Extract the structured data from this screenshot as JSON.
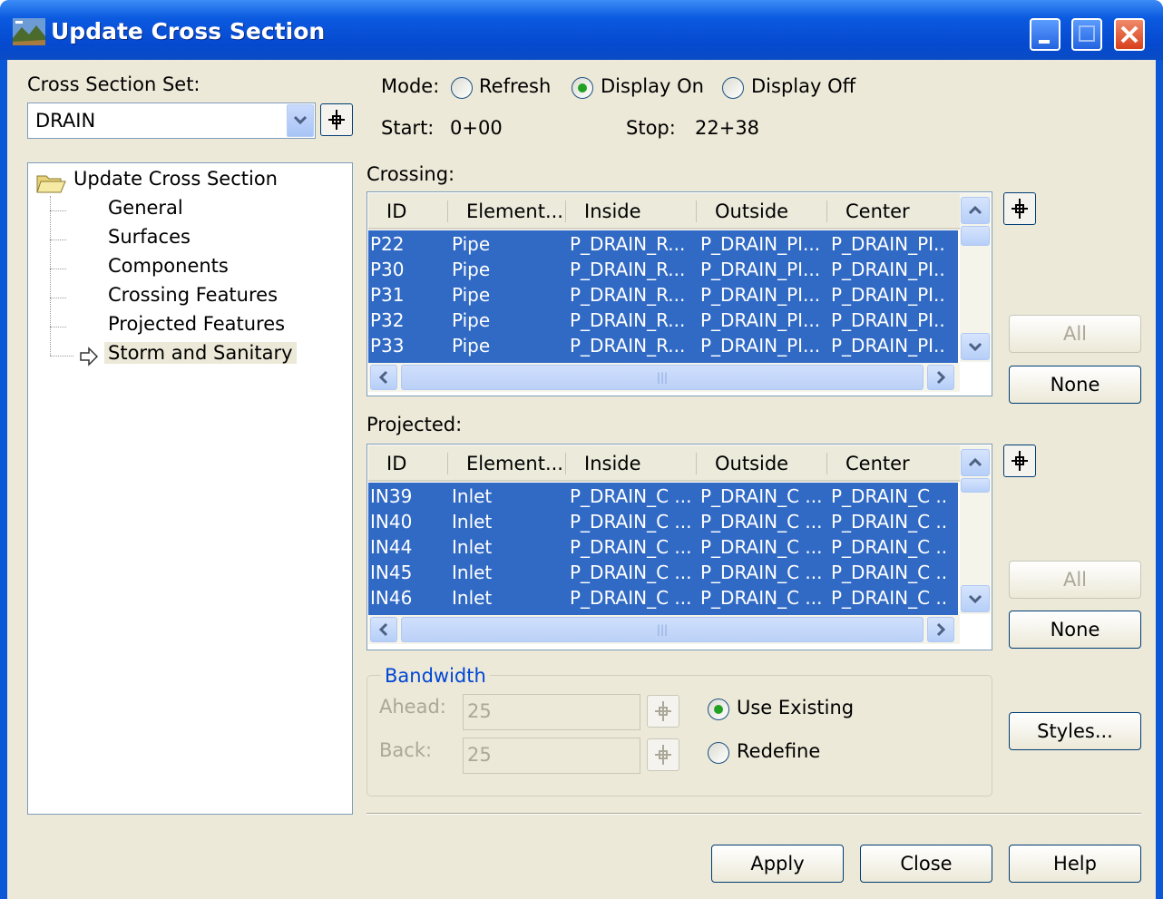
{
  "window": {
    "title": "Update Cross Section"
  },
  "cross_section_set": {
    "label": "Cross Section Set:",
    "value": "DRAIN"
  },
  "mode": {
    "label": "Mode:",
    "options": [
      "Refresh",
      "Display On",
      "Display Off"
    ],
    "selected": "Display On"
  },
  "range": {
    "start_label": "Start:",
    "start_value": "0+00",
    "stop_label": "Stop:",
    "stop_value": "22+38"
  },
  "tree": {
    "root": "Update Cross Section",
    "items": [
      "General",
      "Surfaces",
      "Components",
      "Crossing Features",
      "Projected Features",
      "Storm and Sanitary"
    ],
    "selected": "Storm and Sanitary"
  },
  "crossing": {
    "label": "Crossing:",
    "columns": [
      "ID",
      "Element...",
      "Inside",
      "Outside",
      "Center"
    ],
    "rows": [
      [
        "P22",
        "Pipe",
        "P_DRAIN_R...",
        "P_DRAIN_PI...",
        "P_DRAIN_PI.."
      ],
      [
        "P30",
        "Pipe",
        "P_DRAIN_R...",
        "P_DRAIN_PI...",
        "P_DRAIN_PI.."
      ],
      [
        "P31",
        "Pipe",
        "P_DRAIN_R...",
        "P_DRAIN_PI...",
        "P_DRAIN_PI.."
      ],
      [
        "P32",
        "Pipe",
        "P_DRAIN_R...",
        "P_DRAIN_PI...",
        "P_DRAIN_PI.."
      ],
      [
        "P33",
        "Pipe",
        "P_DRAIN_R...",
        "P_DRAIN_PI...",
        "P_DRAIN_PI.."
      ]
    ],
    "all_label": "All",
    "none_label": "None"
  },
  "projected": {
    "label": "Projected:",
    "columns": [
      "ID",
      "Element...",
      "Inside",
      "Outside",
      "Center"
    ],
    "rows": [
      [
        "IN39",
        "Inlet",
        "P_DRAIN_C ...",
        "P_DRAIN_C ...",
        "P_DRAIN_C .."
      ],
      [
        "IN40",
        "Inlet",
        "P_DRAIN_C ...",
        "P_DRAIN_C ...",
        "P_DRAIN_C .."
      ],
      [
        "IN44",
        "Inlet",
        "P_DRAIN_C ...",
        "P_DRAIN_C ...",
        "P_DRAIN_C .."
      ],
      [
        "IN45",
        "Inlet",
        "P_DRAIN_C ...",
        "P_DRAIN_C ...",
        "P_DRAIN_C .."
      ],
      [
        "IN46",
        "Inlet",
        "P_DRAIN_C ...",
        "P_DRAIN_C ...",
        "P_DRAIN_C .."
      ]
    ],
    "all_label": "All",
    "none_label": "None"
  },
  "bandwidth": {
    "title": "Bandwidth",
    "ahead_label": "Ahead:",
    "ahead_value": "25",
    "back_label": "Back:",
    "back_value": "25",
    "options": [
      "Use Existing",
      "Redefine"
    ],
    "selected": "Use Existing"
  },
  "buttons": {
    "styles": "Styles...",
    "apply": "Apply",
    "close": "Close",
    "help": "Help"
  }
}
